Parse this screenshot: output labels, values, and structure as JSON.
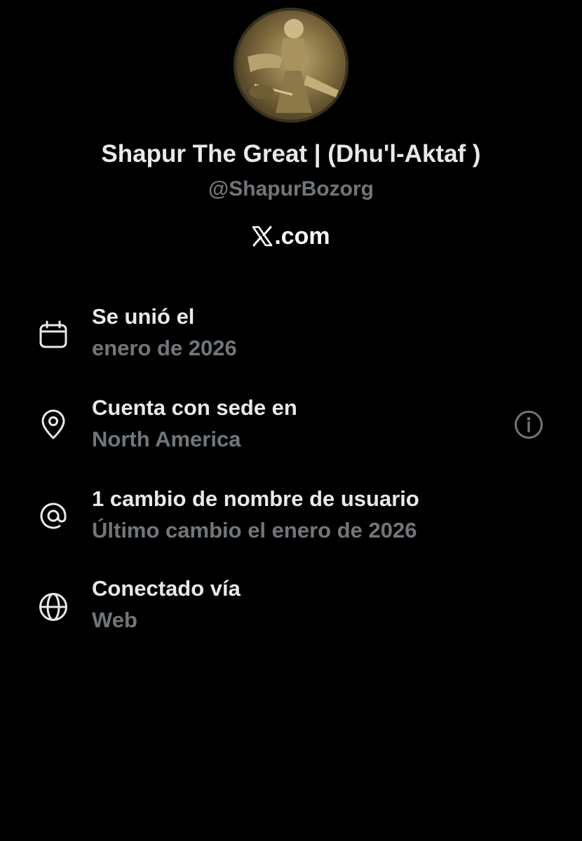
{
  "profile": {
    "avatar_alt": "Shapur The Great",
    "display_name": "Shapur The Great | (Dhu'l-Aktaf )",
    "handle": "@ShapurBozorg",
    "site_suffix": ".com"
  },
  "about": {
    "joined": {
      "title": "Se unió el",
      "value": "enero de 2026",
      "icon": "calendar-icon"
    },
    "location": {
      "title": "Cuenta con sede en",
      "value": "North America",
      "icon": "location-pin-icon",
      "info_icon": "info-icon"
    },
    "username_changes": {
      "title": "1 cambio de nombre de usuario",
      "value": "Último cambio el enero de 2026",
      "icon": "at-sign-icon"
    },
    "connected": {
      "title": "Conectado vía",
      "value": "Web",
      "icon": "globe-icon"
    }
  },
  "colors": {
    "background": "#000000",
    "primary_text": "#e7e9ea",
    "secondary_text": "#71767b"
  }
}
